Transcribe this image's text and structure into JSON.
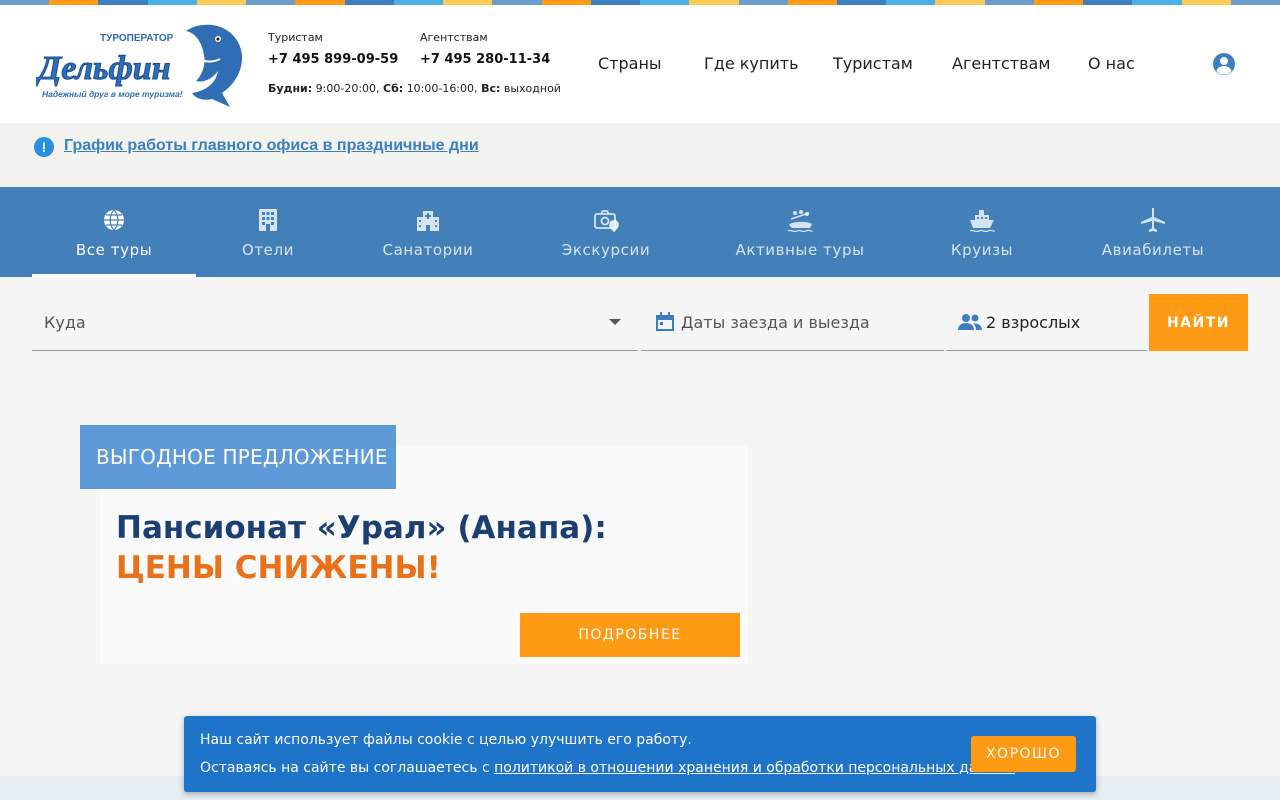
{
  "colors": {
    "accent_orange": "#ff9a14",
    "brand_blue": "#4380b9",
    "dark_blue": "#1b3f73",
    "promo_orange": "#e8711a",
    "stripe": [
      "#6b9ccc",
      "#ff9a14",
      "#3d7ec1",
      "#4ab0e6",
      "#fccb55"
    ]
  },
  "header": {
    "logo_text": "Дельфин",
    "logo_sub": "ТУРОПЕРАТОР",
    "logo_tagline": "Надежный друг в море туризма!",
    "tourists_caption": "Туристам",
    "tourists_phone": "+7 495 899-09-59",
    "agencies_caption": "Агентствам",
    "agencies_phone": "+7 495 280-11-34",
    "hours_weekdays_label": "Будни:",
    "hours_weekdays": "9:00-20:00,",
    "hours_sat_label": "Сб:",
    "hours_sat": "10:00-16:00,",
    "hours_sun_label": "Вс:",
    "hours_sun": "выходной",
    "nav": [
      "Страны",
      "Где купить",
      "Туристам",
      "Агентствам",
      "О нас"
    ],
    "account_icon": "user-circle-icon"
  },
  "notice": {
    "icon": "info-icon",
    "text": "График работы главного офиса в праздничные дни"
  },
  "tabs": [
    {
      "label": "Все туры",
      "icon": "globe-icon",
      "active": true
    },
    {
      "label": "Отели",
      "icon": "hotel-icon",
      "active": false
    },
    {
      "label": "Санатории",
      "icon": "hospital-icon",
      "active": false
    },
    {
      "label": "Экскурсии",
      "icon": "camera-pin-icon",
      "active": false
    },
    {
      "label": "Активные туры",
      "icon": "rafting-icon",
      "active": false
    },
    {
      "label": "Круизы",
      "icon": "ship-icon",
      "active": false
    },
    {
      "label": "Авиабилеты",
      "icon": "plane-icon",
      "active": false
    }
  ],
  "search": {
    "destination_placeholder": "Куда",
    "dates_placeholder": "Даты заезда и выезда",
    "guests_value": "2 взрослых",
    "find_label": "НАЙТИ"
  },
  "promo": {
    "badge": "ВЫГОДНОЕ ПРЕДЛОЖЕНИЕ",
    "title_main": "Пансионат «Урал» (Анапа):",
    "title_highlight": "ЦЕНЫ СНИЖЕНЫ!",
    "button": "ПОДРОБНЕЕ"
  },
  "cookie": {
    "line1": "Наш сайт использует файлы cookie с целью улучшить его работу.",
    "line2_prefix": "Оставаясь на сайте вы соглашаетесь с",
    "line2_link": "политикой в отношении хранения и обработки персональных данных",
    "button": "ХОРОШО"
  }
}
